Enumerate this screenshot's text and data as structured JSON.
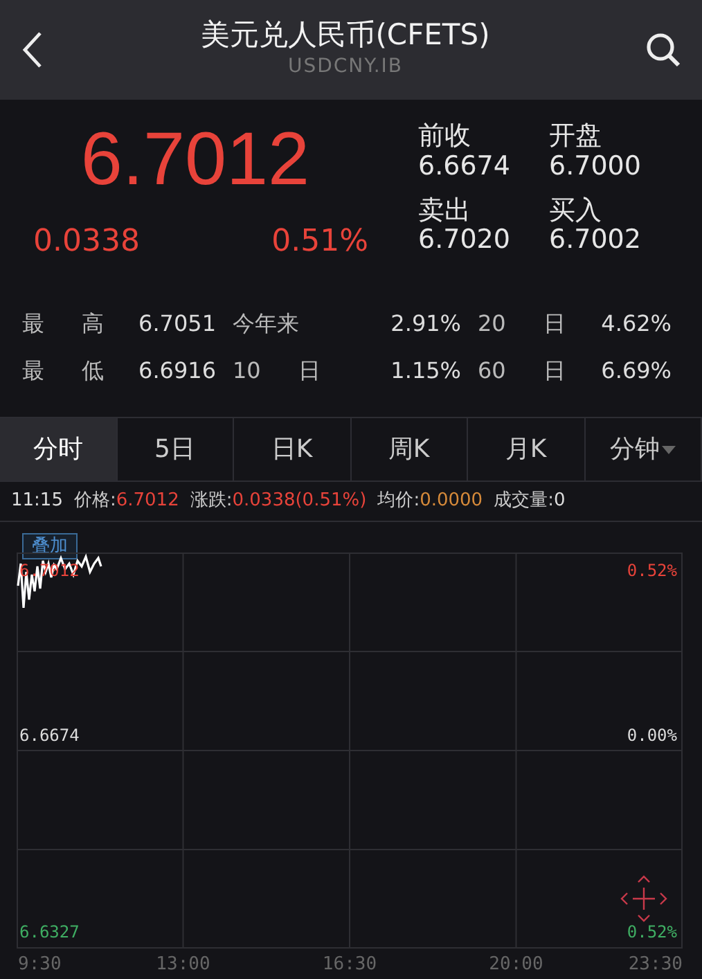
{
  "header": {
    "title": "美元兑人民币(CFETS)",
    "subtitle": "USDCNY.IB"
  },
  "quote": {
    "price": "6.7012",
    "change": "0.0338",
    "change_pct": "0.51%",
    "color": "#e8433a",
    "fields": [
      {
        "label": "前收",
        "value": "6.6674"
      },
      {
        "label": "开盘",
        "value": "6.7000"
      },
      {
        "label": "卖出",
        "value": "6.7020"
      },
      {
        "label": "买入",
        "value": "6.7002"
      }
    ]
  },
  "stats": [
    [
      {
        "label": "最 高",
        "value": "6.7051"
      },
      {
        "label": "今年来",
        "value": "2.91%"
      },
      {
        "label": "20 日",
        "value": "4.62%"
      }
    ],
    [
      {
        "label": "最 低",
        "value": "6.6916"
      },
      {
        "label": "10 日",
        "value": "1.15%"
      },
      {
        "label": "60 日",
        "value": "6.69%"
      }
    ]
  ],
  "tabs": [
    {
      "label": "分时",
      "selected": true,
      "dropdown": false
    },
    {
      "label": "5日",
      "selected": false,
      "dropdown": false
    },
    {
      "label": "日K",
      "selected": false,
      "dropdown": false
    },
    {
      "label": "周K",
      "selected": false,
      "dropdown": false
    },
    {
      "label": "月K",
      "selected": false,
      "dropdown": false
    },
    {
      "label": "分钟",
      "selected": false,
      "dropdown": true
    }
  ],
  "info": [
    {
      "kind": "time",
      "text": "11:15"
    },
    {
      "kind": "up",
      "label": "价格:",
      "text": "6.7012"
    },
    {
      "kind": "up",
      "label": "涨跌:",
      "text": "0.0338(0.51%)"
    },
    {
      "kind": "avg",
      "label": "均价:",
      "text": "0.0000"
    },
    {
      "kind": "plain",
      "label": "成交量:",
      "text": "0"
    }
  ],
  "overlay_button": "叠加",
  "chart": {
    "price_labels": [
      {
        "text": "6.7012",
        "color": "#e8433a"
      },
      {
        "text": "6.6674",
        "color": "#dddddd"
      },
      {
        "text": "6.6327",
        "color": "#3fae63"
      }
    ],
    "pct_labels": [
      {
        "text": "0.52%",
        "color": "#e8433a"
      },
      {
        "text": "0.00%",
        "color": "#dddddd"
      },
      {
        "text": "0.52%",
        "color": "#3fae63"
      }
    ],
    "times": [
      "9:30",
      "13:00",
      "16:30",
      "20:00",
      "23:30"
    ]
  }
}
